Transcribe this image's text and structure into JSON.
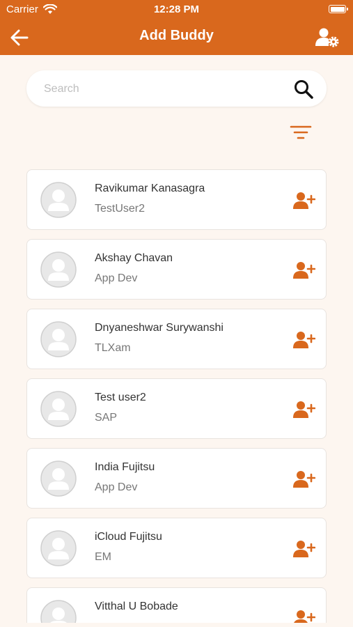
{
  "status_bar": {
    "carrier": "Carrier",
    "time": "12:28 PM"
  },
  "header": {
    "title": "Add Buddy"
  },
  "search": {
    "placeholder": "Search"
  },
  "colors": {
    "accent": "#d9681d",
    "background": "#fdf6f0"
  },
  "buddies": [
    {
      "name": "Ravikumar Kanasagra",
      "subtitle": "TestUser2"
    },
    {
      "name": "Akshay Chavan",
      "subtitle": "App Dev"
    },
    {
      "name": "Dnyaneshwar Surywanshi",
      "subtitle": "TLXam"
    },
    {
      "name": "Test user2",
      "subtitle": "SAP"
    },
    {
      "name": "India Fujitsu",
      "subtitle": "App Dev"
    },
    {
      "name": "iCloud Fujitsu",
      "subtitle": "EM"
    },
    {
      "name": "Vitthal U Bobade",
      "subtitle": ""
    }
  ]
}
